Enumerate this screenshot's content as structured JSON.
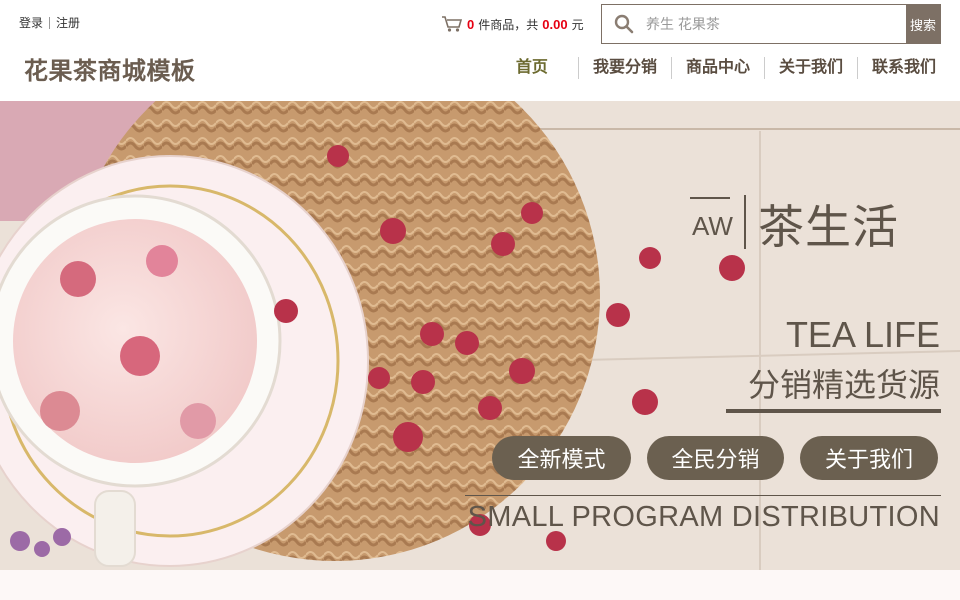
{
  "header": {
    "auth": {
      "login": "登录",
      "register": "注册"
    },
    "cart": {
      "count": "0",
      "count_suffix": "件商品，共",
      "amount": "0.00",
      "currency": "元",
      "icon": "cart-icon"
    },
    "search": {
      "placeholder": "养生 花果茶",
      "button": "搜索",
      "icon": "search-icon"
    },
    "logo": "花果茶商城模板",
    "nav": [
      "首页",
      "我要分销",
      "商品中心",
      "关于我们",
      "联系我们"
    ]
  },
  "banner": {
    "prefix_char": "AW",
    "title": "茶生活",
    "en_title": "TEA LIFE",
    "subtitle": "分销精选货源",
    "buttons": [
      "全新模式",
      "全民分销",
      "关于我们"
    ],
    "footer": "SMALL PROGRAM DISTRIBUTION"
  },
  "colors": {
    "accent": "#7d7065",
    "price": "#e60012",
    "banner_text": "#5f554a"
  }
}
